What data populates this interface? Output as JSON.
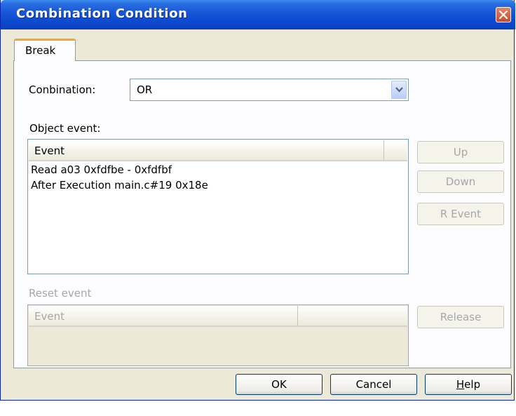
{
  "window": {
    "title": "Combination Condition"
  },
  "tabs": [
    {
      "label": "Break"
    }
  ],
  "combination": {
    "label": "Conbination:",
    "value": "OR"
  },
  "object_event": {
    "label": "Object event:",
    "column_header": "Event",
    "rows": [
      "Read a03 0xfdfbe - 0xfdfbf",
      "After Execution main.c#19 0x18e"
    ]
  },
  "reset_event": {
    "label": "Reset event",
    "column_header": "Event",
    "rows": []
  },
  "side_buttons": {
    "up": "Up",
    "down": "Down",
    "r_event": "R Event",
    "release": "Release"
  },
  "footer_buttons": {
    "ok": "OK",
    "cancel": "Cancel",
    "help_underlined": "H",
    "help_rest": "elp"
  },
  "colors": {
    "titlebar": "#0c4bd0",
    "dialog_bg": "#ece9d8",
    "tab_accent": "#f5a623",
    "disabled_text": "#a7a6aa"
  }
}
